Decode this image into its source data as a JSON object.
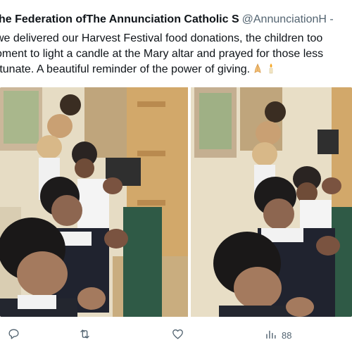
{
  "tweet": {
    "author_name": "he Federation ofThe Annunciation Catholic S",
    "handle": "@AnnunciationH -",
    "text_lines": [
      " we delivered our Harvest Festival food donations, the children too",
      "oment to light a candle at the Mary altar and prayed for those less",
      "rtunate. A beautiful reminder of the power of giving."
    ],
    "emojis": [
      "folded-hands-icon",
      "candle-icon"
    ]
  },
  "media": {
    "count": 2,
    "alt": [
      "Children kneeling and praying",
      "Children kneeling and praying"
    ]
  },
  "actions": {
    "reply_icon": "reply-icon",
    "retweet_icon": "retweet-icon",
    "like_icon": "heart-icon",
    "views_icon": "views-icon",
    "views_count": "88"
  },
  "colors": {
    "text": "#0f1419",
    "secondary": "#536471"
  }
}
